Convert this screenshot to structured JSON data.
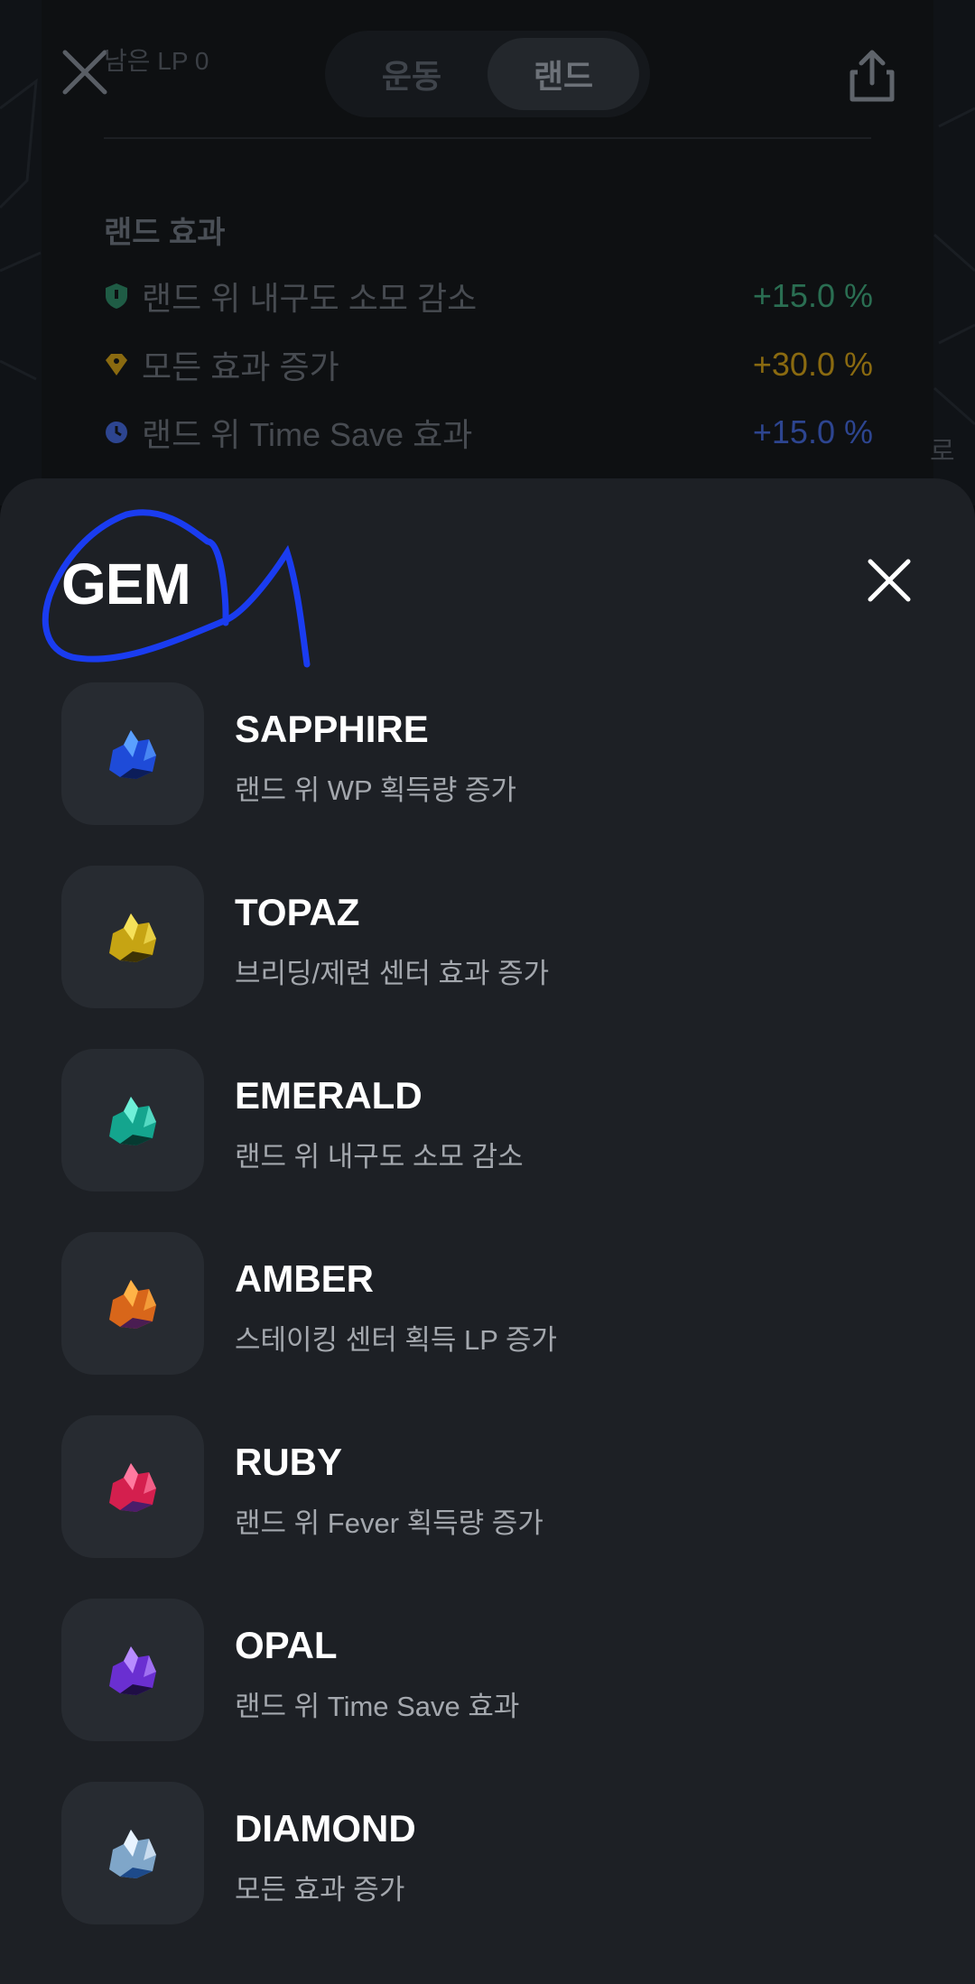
{
  "background": {
    "lp_remaining": "남은 LP 0",
    "tabs": [
      {
        "label": "운동",
        "selected": false
      },
      {
        "label": "랜드",
        "selected": true
      }
    ],
    "effects_title": "랜드 효과",
    "effects": [
      {
        "label": "랜드 위 내구도 소모 감소",
        "value": "+15.0 %",
        "color": "#2e8b63",
        "icon": "shield-icon"
      },
      {
        "label": "모든 효과 증가",
        "value": "+30.0 %",
        "color": "#b8860b",
        "icon": "diamond-icon"
      },
      {
        "label": "랜드 위 Time Save 효과",
        "value": "+15.0 %",
        "color": "#3a57b8",
        "icon": "clock-icon"
      }
    ],
    "side_text": "로"
  },
  "sheet": {
    "title": "GEM",
    "gems": [
      {
        "name": "SAPPHIRE",
        "description": "랜드 위 WP 획득량 증가",
        "color": "#1e4bd8",
        "highlight": "#5aa0ff"
      },
      {
        "name": "TOPAZ",
        "description": "브리딩/제련 센터 효과 증가",
        "color": "#c6a413",
        "highlight": "#f5e15a"
      },
      {
        "name": "EMERALD",
        "description": "랜드 위 내구도 소모 감소",
        "color": "#14a58e",
        "highlight": "#6ff0d8"
      },
      {
        "name": "AMBER",
        "description": "스테이킹 센터 획득 LP 증가",
        "color": "#d8661a",
        "highlight": "#ffb347"
      },
      {
        "name": "RUBY",
        "description": "랜드 위 Fever 획득량 증가",
        "color": "#d41f4e",
        "highlight": "#ff7aa0"
      },
      {
        "name": "OPAL",
        "description": "랜드 위 Time Save 효과",
        "color": "#6a2fd1",
        "highlight": "#b88cff"
      },
      {
        "name": "DIAMOND",
        "description": "모든 효과 증가",
        "color": "#7fa6c9",
        "highlight": "#e8f3ff"
      }
    ]
  },
  "colors": {
    "sheet_bg": "#1d2025",
    "annotation": "#1a3cf0"
  }
}
